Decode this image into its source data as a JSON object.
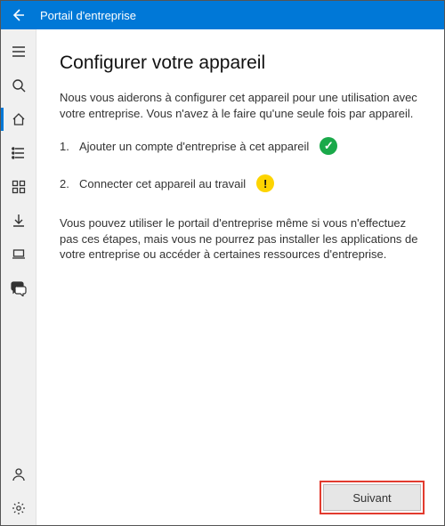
{
  "titlebar": {
    "app_title": "Portail d'entreprise"
  },
  "sidebar": {
    "items": [
      {
        "name": "hamburger-icon"
      },
      {
        "name": "search-icon"
      },
      {
        "name": "home-icon",
        "active": true
      },
      {
        "name": "list-icon"
      },
      {
        "name": "grid-icon"
      },
      {
        "name": "download-icon"
      },
      {
        "name": "laptop-icon"
      },
      {
        "name": "chat-icon"
      }
    ],
    "bottom": [
      {
        "name": "person-icon"
      },
      {
        "name": "gear-icon"
      }
    ]
  },
  "content": {
    "heading": "Configurer votre appareil",
    "intro": "Nous vous aiderons à configurer cet appareil pour une utilisation avec votre entreprise. Vous n'avez à le faire qu'une seule fois par appareil.",
    "steps": [
      {
        "num": "1.",
        "text": "Ajouter un compte d'entreprise à cet appareil",
        "status": "done"
      },
      {
        "num": "2.",
        "text": "Connecter cet appareil au travail",
        "status": "warn"
      }
    ],
    "note": "Vous pouvez utiliser le portail d'entreprise même si vous n'effectuez pas ces étapes, mais vous ne pourrez pas installer les applications de votre entreprise ou accéder à certaines ressources d'entreprise.",
    "next_label": "Suivant"
  }
}
